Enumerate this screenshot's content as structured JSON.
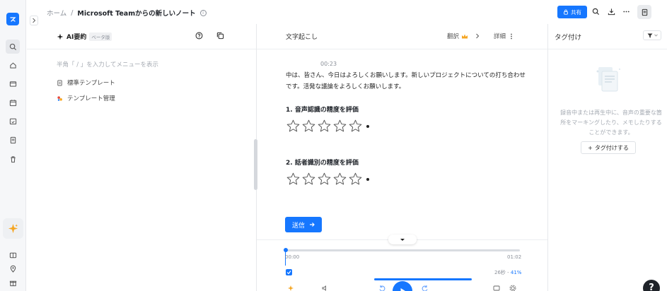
{
  "breadcrumb": {
    "home": "ホーム",
    "separator": "/",
    "current": "Microsoft Teamからの新しいノート"
  },
  "toolbar": {
    "share_label": "共有"
  },
  "ai_panel": {
    "title": "AI要約",
    "beta_badge": "ベータ版",
    "hint": "半角「 / 」を入力してメニューを表示",
    "menu": [
      {
        "label": "標準テンプレート",
        "icon": "document-icon"
      },
      {
        "label": "テンプレート管理",
        "icon": "template-manage-icon"
      }
    ]
  },
  "transcript": {
    "title": "文字起こし",
    "translate_label": "翻訳",
    "details_label": "詳細",
    "timestamp": "00:23",
    "text": "中は、皆さん、今日はよろしくお願いします。新しいプロジェクトについての打ち合わせです。活発な議論をよろしくお願いします。",
    "questions": [
      {
        "title": "1. 音声認識の精度を評価",
        "rating": 0,
        "max": 5
      },
      {
        "title": "2. 話者識別の精度を評価",
        "rating": 0,
        "max": 5
      }
    ],
    "submit_label": "送信"
  },
  "player": {
    "current_time": "00:00",
    "total_time": "01:02",
    "speed_text": "26秒 - ",
    "speed_pct": "41%",
    "progress": 0.0
  },
  "tags": {
    "title": "タグ付け",
    "empty_hint": "録音中または再生中に、音声の重要な箇所をマーキングしたり、メモしたりすることができます。",
    "add_label": "タグ付けする"
  },
  "help_label": "?",
  "colors": {
    "accent": "#1677ff",
    "sidebar_bg": "#f6f7f9",
    "ai_sparkle": "#f5a623"
  }
}
